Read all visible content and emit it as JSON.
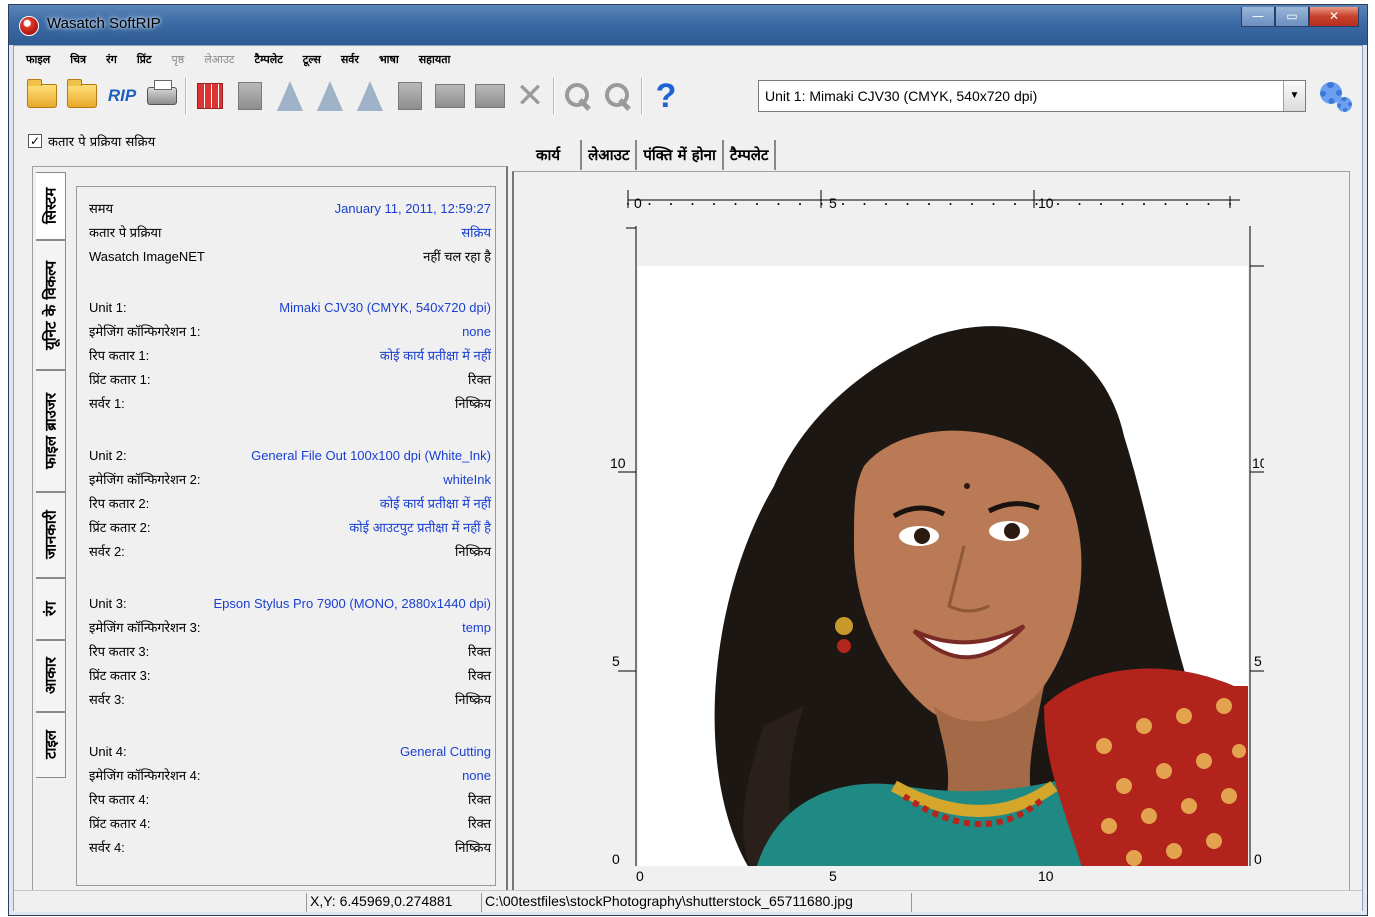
{
  "window": {
    "title": "Wasatch SoftRIP",
    "minimize_glyph": "—",
    "maximize_glyph": "▭",
    "close_glyph": "✕"
  },
  "menu": [
    {
      "label": "फाइल",
      "enabled": true
    },
    {
      "label": "चित्र",
      "enabled": true
    },
    {
      "label": "रंग",
      "enabled": true
    },
    {
      "label": "प्रिंट",
      "enabled": true
    },
    {
      "label": "पृष्ठ",
      "enabled": false
    },
    {
      "label": "लेआउट",
      "enabled": false
    },
    {
      "label": "टैम्पलेट",
      "enabled": true
    },
    {
      "label": "टूल्स",
      "enabled": true
    },
    {
      "label": "सर्वर",
      "enabled": true
    },
    {
      "label": "भाषा",
      "enabled": true
    },
    {
      "label": "सहायता",
      "enabled": true
    }
  ],
  "toolbar": {
    "rip_label": "RIP",
    "help_glyph": "?",
    "delete_glyph": "✕",
    "printer_select": {
      "value": "Unit 1: Mimaki CJV30  (CMYK, 540x720 dpi)",
      "arrow": "▼"
    }
  },
  "queue": {
    "checkbox_label": "कतार पे प्रक्रिया सक्रिय",
    "checked": true,
    "check_glyph": "✓"
  },
  "side_tabs": [
    "सिस्टम",
    "यूनिट के विकल्प",
    "फाइल ब्राउजर",
    "जानकारी",
    "रंग",
    "आकार",
    "टाइल"
  ],
  "system": {
    "general": [
      {
        "label": "समय",
        "value": "January 11, 2011,  12:59:27",
        "color": "blue"
      },
      {
        "label": "कतार पे प्रक्रिया",
        "value": "सक्रिय",
        "color": "blue"
      },
      {
        "label": "Wasatch ImageNET",
        "value": "नहीं चल रहा है",
        "color": "black"
      }
    ],
    "units": [
      {
        "rows": [
          {
            "label": "Unit 1:",
            "value": "Mimaki CJV30  (CMYK, 540x720 dpi)",
            "color": "blue"
          },
          {
            "label": "इमेजिंग कॉन्फिगरेशन 1:",
            "value": "none",
            "color": "blue"
          },
          {
            "label": "रिप कतार 1:",
            "value": "कोई कार्य प्रतीक्षा में नहीं",
            "color": "blue"
          },
          {
            "label": "प्रिंट कतार 1:",
            "value": "रिक्त",
            "color": "black"
          },
          {
            "label": "सर्वर 1:",
            "value": "निष्क्रिय",
            "color": "black"
          }
        ]
      },
      {
        "rows": [
          {
            "label": "Unit 2:",
            "value": "General File Out 100x100 dpi (White_Ink)",
            "color": "blue"
          },
          {
            "label": "इमेजिंग कॉन्फिगरेशन 2:",
            "value": "whiteInk",
            "color": "blue"
          },
          {
            "label": "रिप कतार 2:",
            "value": "कोई कार्य प्रतीक्षा में नहीं",
            "color": "blue"
          },
          {
            "label": "प्रिंट कतार 2:",
            "value": "कोई आउटपुट प्रतीक्षा में नहीं है",
            "color": "blue"
          },
          {
            "label": "सर्वर 2:",
            "value": "निष्क्रिय",
            "color": "black"
          }
        ]
      },
      {
        "rows": [
          {
            "label": "Unit 3:",
            "value": "Epson Stylus Pro 7900  (MONO, 2880x1440 dpi)",
            "color": "blue"
          },
          {
            "label": "इमेजिंग कॉन्फिगरेशन 3:",
            "value": "temp",
            "color": "blue"
          },
          {
            "label": "रिप कतार 3:",
            "value": "रिक्त",
            "color": "black"
          },
          {
            "label": "प्रिंट कतार 3:",
            "value": "रिक्त",
            "color": "black"
          },
          {
            "label": "सर्वर 3:",
            "value": "निष्क्रिय",
            "color": "black"
          }
        ]
      },
      {
        "rows": [
          {
            "label": "Unit 4:",
            "value": "General Cutting",
            "color": "blue"
          },
          {
            "label": "इमेजिंग कॉन्फिगरेशन 4:",
            "value": "none",
            "color": "blue"
          },
          {
            "label": "रिप कतार 4:",
            "value": "रिक्त",
            "color": "black"
          },
          {
            "label": "प्रिंट कतार 4:",
            "value": "रिक्त",
            "color": "black"
          },
          {
            "label": "सर्वर 4:",
            "value": "निष्क्रिय",
            "color": "black"
          }
        ]
      }
    ]
  },
  "preview_tabs": [
    "कार्य",
    "लेआउट",
    "पंक्ति में होना",
    "टैम्पलेट"
  ],
  "ruler": {
    "top_labels": [
      "0",
      "5",
      "10"
    ],
    "bottom_labels": [
      "0",
      "5",
      "10"
    ],
    "left_labels": [
      "10",
      "5",
      "0"
    ],
    "right_labels": [
      "10",
      "5",
      "0"
    ]
  },
  "status": {
    "coords": "X,Y: 6.45969,0.274881",
    "file": "C:\\00testfiles\\stockPhotography\\shutterstock_65711680.jpg"
  },
  "colors": {
    "value_blue": "#1a3fd0",
    "titlebar": "#3b6aa4"
  }
}
